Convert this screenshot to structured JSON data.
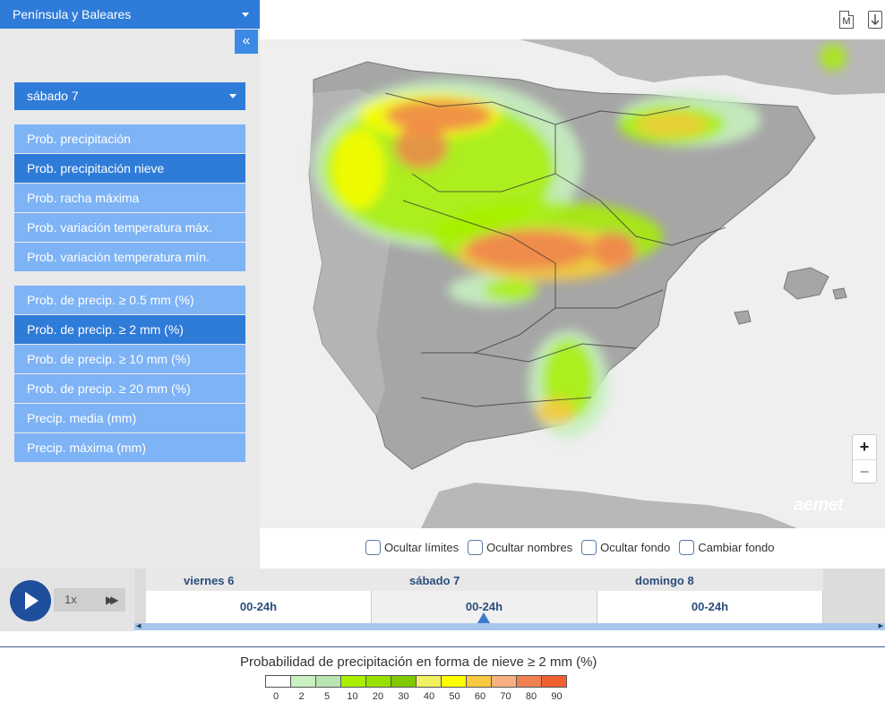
{
  "sidebar": {
    "region": "Península y Baleares",
    "collapse_label": "«",
    "day": "sábado 7",
    "variables": [
      {
        "label": "Prob. precipitación",
        "active": false
      },
      {
        "label": "Prob. precipitación nieve",
        "active": true
      },
      {
        "label": "Prob. racha máxima",
        "active": false
      },
      {
        "label": "Prob. variación temperatura máx.",
        "active": false
      },
      {
        "label": "Prob. variación temperatura mín.",
        "active": false
      }
    ],
    "thresholds": [
      {
        "label": "Prob. de precip. ≥ 0.5 mm (%)",
        "active": false
      },
      {
        "label": "Prob. de precip. ≥ 2 mm (%)",
        "active": true
      },
      {
        "label": "Prob. de precip. ≥ 10 mm (%)",
        "active": false
      },
      {
        "label": "Prob. de precip. ≥ 20 mm (%)",
        "active": false
      },
      {
        "label": "Precip. media (mm)",
        "active": false
      },
      {
        "label": "Precip. máxima (mm)",
        "active": false
      }
    ]
  },
  "toolbar": {
    "m_label": "M",
    "download_icon": "download-icon"
  },
  "map": {
    "zoom_in": "+",
    "zoom_out": "−",
    "logo": "aemet",
    "colors": {
      "land": "#a6a6a6",
      "sea": "#efefef",
      "border": "#444444"
    }
  },
  "options": [
    {
      "label": "Ocultar límites"
    },
    {
      "label": "Ocultar nombres"
    },
    {
      "label": "Ocultar fondo"
    },
    {
      "label": "Cambiar fondo"
    }
  ],
  "player": {
    "speed": "1x",
    "ff_label": "▶▶"
  },
  "timeline": [
    {
      "day": "viernes 6",
      "slot": "00-24h",
      "selected": false
    },
    {
      "day": "sábado 7",
      "slot": "00-24h",
      "selected": true
    },
    {
      "day": "domingo 8",
      "slot": "00-24h",
      "selected": false
    }
  ],
  "legend": {
    "title": "Probabilidad de precipitación en forma de nieve ≥ 2 mm (%)",
    "ticks": [
      "0",
      "2",
      "5",
      "10",
      "20",
      "30",
      "40",
      "50",
      "60",
      "70",
      "80",
      "90"
    ],
    "colors": [
      "#ffffff",
      "#c8f0c0",
      "#b8e4b0",
      "#a8f000",
      "#98e000",
      "#80c800",
      "#f0f060",
      "#ffff00",
      "#f8c840",
      "#f8b080",
      "#f08050",
      "#f06030"
    ]
  }
}
